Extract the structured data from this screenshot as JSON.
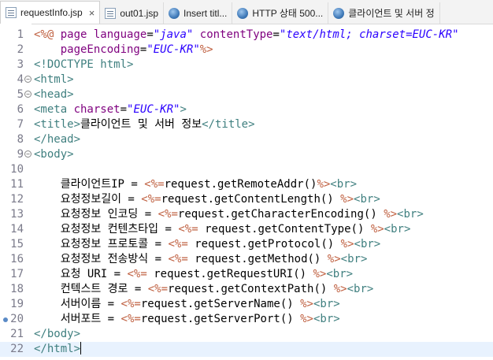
{
  "tabs": [
    {
      "label": "requestInfo.jsp",
      "icon": "jsp-file-icon",
      "active": true,
      "closable": true
    },
    {
      "label": "out01.jsp",
      "icon": "jsp-file-icon",
      "active": false
    },
    {
      "label": "Insert titl...",
      "icon": "globe-icon",
      "active": false
    },
    {
      "label": "HTTP 상태 500...",
      "icon": "globe-icon",
      "active": false
    },
    {
      "label": "클라이언트 및 서버 정",
      "icon": "globe-icon",
      "active": false
    }
  ],
  "close_glyph": "×",
  "colors": {
    "tag": "#3f7f7f",
    "attr": "#7f007f",
    "value": "#2a00ff",
    "directive": "#bf5f3f"
  },
  "lines": [
    {
      "n": "1",
      "fold": false,
      "segs": [
        [
          "d",
          "<%@ "
        ],
        [
          "a",
          "page "
        ],
        [
          "a",
          "language"
        ],
        [
          "p",
          "="
        ],
        [
          "v",
          "\"java\""
        ],
        [
          "p",
          " "
        ],
        [
          "a",
          "contentType"
        ],
        [
          "p",
          "="
        ],
        [
          "v",
          "\"text/html; charset=EUC-KR\""
        ]
      ]
    },
    {
      "n": "2",
      "fold": false,
      "segs": [
        [
          "p",
          "    "
        ],
        [
          "a",
          "pageEncoding"
        ],
        [
          "p",
          "="
        ],
        [
          "v",
          "\"EUC-KR\""
        ],
        [
          "d",
          "%>"
        ]
      ]
    },
    {
      "n": "3",
      "fold": false,
      "segs": [
        [
          "t",
          "<!DOCTYPE html>"
        ]
      ]
    },
    {
      "n": "4",
      "fold": true,
      "segs": [
        [
          "t",
          "<html>"
        ]
      ]
    },
    {
      "n": "5",
      "fold": true,
      "segs": [
        [
          "t",
          "<head>"
        ]
      ]
    },
    {
      "n": "6",
      "fold": false,
      "segs": [
        [
          "t",
          "<meta "
        ],
        [
          "a",
          "charset"
        ],
        [
          "p",
          "="
        ],
        [
          "v",
          "\"EUC-KR\""
        ],
        [
          "t",
          ">"
        ]
      ]
    },
    {
      "n": "7",
      "fold": false,
      "segs": [
        [
          "t",
          "<title>"
        ],
        [
          "ko",
          "클라이언트 및 서버 정보"
        ],
        [
          "t",
          "</title>"
        ]
      ]
    },
    {
      "n": "8",
      "fold": false,
      "segs": [
        [
          "t",
          "</head>"
        ]
      ]
    },
    {
      "n": "9",
      "fold": true,
      "segs": [
        [
          "t",
          "<body>"
        ]
      ]
    },
    {
      "n": "10",
      "fold": false,
      "segs": []
    },
    {
      "n": "11",
      "fold": false,
      "segs": [
        [
          "p",
          "    "
        ],
        [
          "ko",
          "클라이언트IP = "
        ],
        [
          "d",
          "<%="
        ],
        [
          "p",
          "request.getRemoteAddr()"
        ],
        [
          "d",
          "%>"
        ],
        [
          "t",
          "<br>"
        ]
      ]
    },
    {
      "n": "12",
      "fold": false,
      "segs": [
        [
          "p",
          "    "
        ],
        [
          "ko",
          "요청정보길이 = "
        ],
        [
          "d",
          "<%="
        ],
        [
          "p",
          "request.getContentLength() "
        ],
        [
          "d",
          "%>"
        ],
        [
          "t",
          "<br>"
        ]
      ]
    },
    {
      "n": "13",
      "fold": false,
      "segs": [
        [
          "p",
          "    "
        ],
        [
          "ko",
          "요청정보 인코딩 = "
        ],
        [
          "d",
          "<%="
        ],
        [
          "p",
          "request.getCharacterEncoding() "
        ],
        [
          "d",
          "%>"
        ],
        [
          "t",
          "<br>"
        ]
      ]
    },
    {
      "n": "14",
      "fold": false,
      "segs": [
        [
          "p",
          "    "
        ],
        [
          "ko",
          "요청정보 컨텐츠타입 = "
        ],
        [
          "d",
          "<%="
        ],
        [
          "p",
          " request.getContentType() "
        ],
        [
          "d",
          "%>"
        ],
        [
          "t",
          "<br>"
        ]
      ]
    },
    {
      "n": "15",
      "fold": false,
      "segs": [
        [
          "p",
          "    "
        ],
        [
          "ko",
          "요청정보 프로토콜 = "
        ],
        [
          "d",
          "<%="
        ],
        [
          "p",
          " request.getProtocol() "
        ],
        [
          "d",
          "%>"
        ],
        [
          "t",
          "<br>"
        ]
      ]
    },
    {
      "n": "16",
      "fold": false,
      "segs": [
        [
          "p",
          "    "
        ],
        [
          "ko",
          "요청정보 전송방식 = "
        ],
        [
          "d",
          "<%="
        ],
        [
          "p",
          " request.getMethod() "
        ],
        [
          "d",
          "%>"
        ],
        [
          "t",
          "<br>"
        ]
      ]
    },
    {
      "n": "17",
      "fold": false,
      "segs": [
        [
          "p",
          "    "
        ],
        [
          "ko",
          "요청 URI = "
        ],
        [
          "d",
          "<%="
        ],
        [
          "p",
          " request.getRequestURI() "
        ],
        [
          "d",
          "%>"
        ],
        [
          "t",
          "<br>"
        ]
      ]
    },
    {
      "n": "18",
      "fold": false,
      "segs": [
        [
          "p",
          "    "
        ],
        [
          "ko",
          "컨텍스트 경로 = "
        ],
        [
          "d",
          "<%="
        ],
        [
          "p",
          "request.getContextPath() "
        ],
        [
          "d",
          "%>"
        ],
        [
          "t",
          "<br>"
        ]
      ]
    },
    {
      "n": "19",
      "fold": false,
      "segs": [
        [
          "p",
          "    "
        ],
        [
          "ko",
          "서버이름 = "
        ],
        [
          "d",
          "<%="
        ],
        [
          "p",
          "request.getServerName() "
        ],
        [
          "d",
          "%>"
        ],
        [
          "t",
          "<br>"
        ]
      ]
    },
    {
      "n": "20",
      "fold": false,
      "marker": true,
      "segs": [
        [
          "p",
          "    "
        ],
        [
          "ko",
          "서버포트 = "
        ],
        [
          "d",
          "<%="
        ],
        [
          "p",
          "request.getServerPort() "
        ],
        [
          "d",
          "%>"
        ],
        [
          "t",
          "<br>"
        ]
      ]
    },
    {
      "n": "21",
      "fold": false,
      "segs": [
        [
          "t",
          "</body>"
        ]
      ]
    },
    {
      "n": "22",
      "fold": false,
      "current": true,
      "segs": [
        [
          "t",
          "</html>"
        ]
      ]
    }
  ]
}
